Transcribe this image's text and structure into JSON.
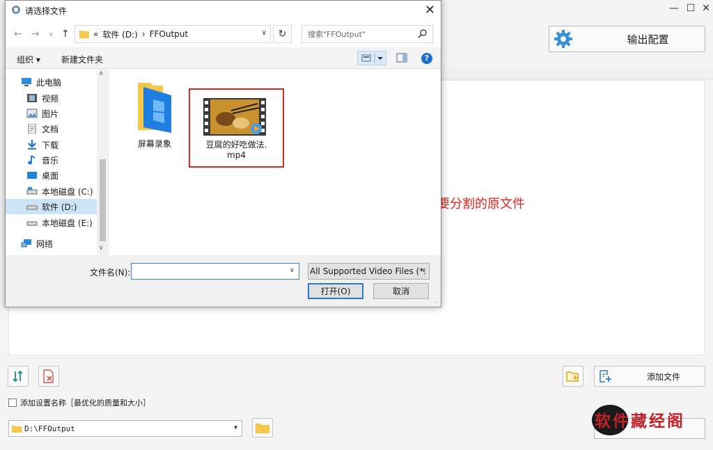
{
  "app": {
    "output_config_label": "输出配置",
    "add_file_label": "添加文件",
    "checkbox_label": "添加设置名称［最优化的质量和大小］",
    "output_path": "D:\\FFOutput"
  },
  "annotation": {
    "text": "添加要分割的原文件"
  },
  "watermark": {
    "text": "软件藏经阁"
  },
  "dialog": {
    "title": "请选择文件",
    "address": {
      "prefix": "«",
      "drive": "软件 (D:)",
      "sep": "›",
      "folder": "FFOutput"
    },
    "search_placeholder": "搜索\"FFOutput\"",
    "organize_label": "组织 ▾",
    "new_folder_label": "新建文件夹",
    "nav_items": [
      {
        "label": "此电脑",
        "icon": "computer-icon"
      },
      {
        "label": "视频",
        "icon": "video-icon"
      },
      {
        "label": "图片",
        "icon": "picture-icon"
      },
      {
        "label": "文档",
        "icon": "document-icon"
      },
      {
        "label": "下载",
        "icon": "download-icon"
      },
      {
        "label": "音乐",
        "icon": "music-icon"
      },
      {
        "label": "桌面",
        "icon": "desktop-icon"
      },
      {
        "label": "本地磁盘 (C:)",
        "icon": "drive-icon"
      },
      {
        "label": "软件 (D:)",
        "icon": "drive-icon",
        "selected": true
      },
      {
        "label": "本地磁盘 (E:)",
        "icon": "drive-icon"
      },
      {
        "label": "网络",
        "icon": "network-icon"
      }
    ],
    "files": [
      {
        "name": "屏幕录象",
        "type": "folder"
      },
      {
        "name_line1": "豆腐的好吃做法.",
        "name_line2": "mp4",
        "type": "video"
      }
    ],
    "filename_label": "文件名(N):",
    "filename_value": "",
    "filter_value": "All Supported Video Files (*.",
    "open_label": "打开(O)",
    "cancel_label": "取消"
  },
  "colors": {
    "annotation_red": "#e0231d",
    "selection_blue": "#cce3f8",
    "folder_yellow": "#f5c84c"
  }
}
